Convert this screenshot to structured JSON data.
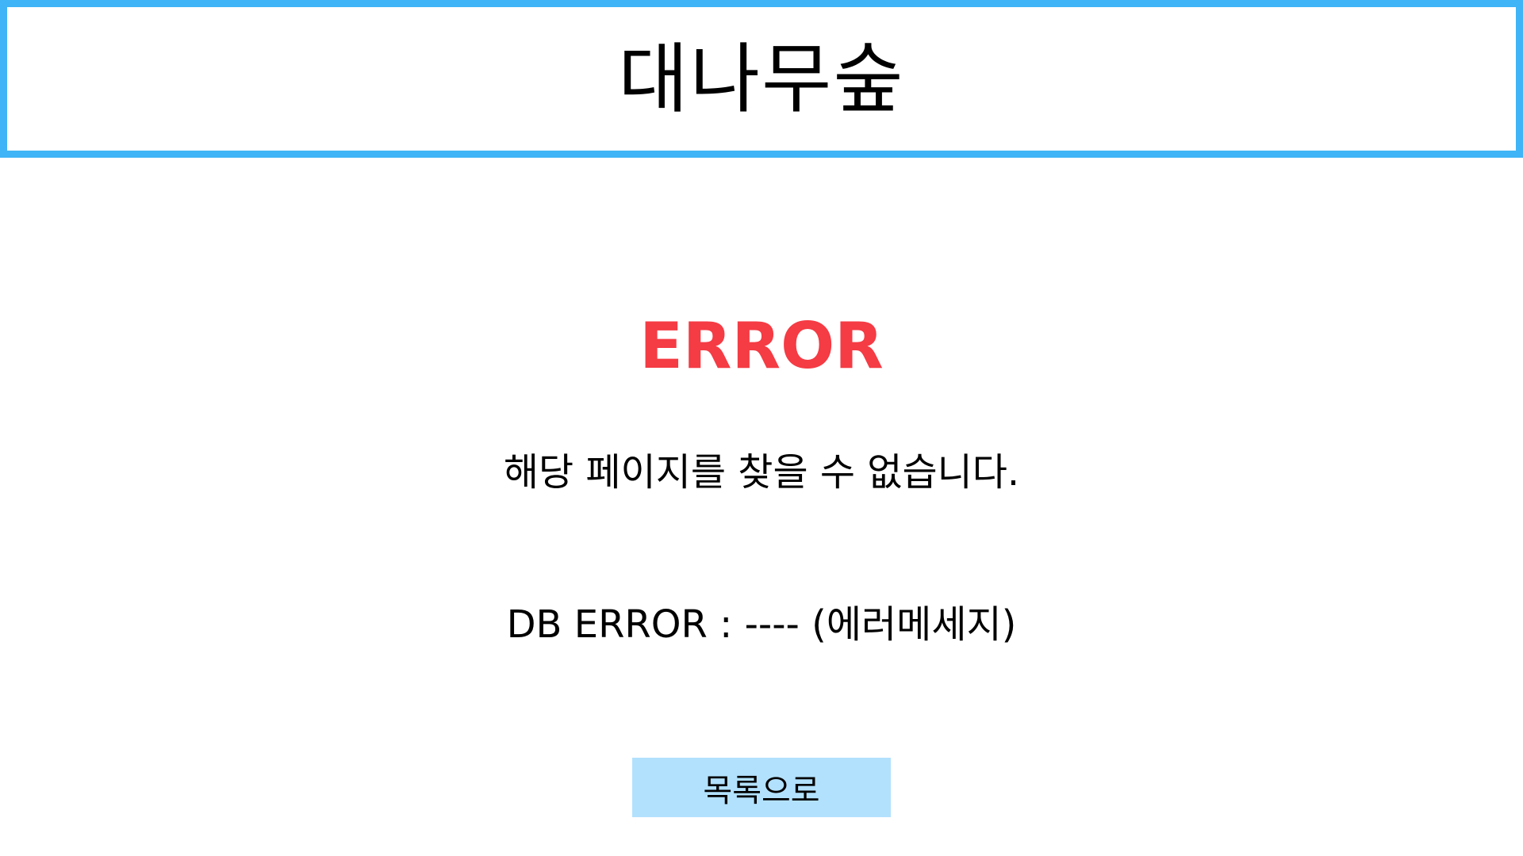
{
  "header": {
    "title": "대나무숲"
  },
  "error": {
    "title": "ERROR",
    "message": "해당 페이지를 찾을 수 없습니다.",
    "db_error": "DB ERROR : ---- (에러메세지)"
  },
  "actions": {
    "back_label": "목록으로"
  },
  "colors": {
    "header_border": "#3fb4f6",
    "error_title": "#f53b44",
    "button_bg": "#b2e1fd"
  }
}
